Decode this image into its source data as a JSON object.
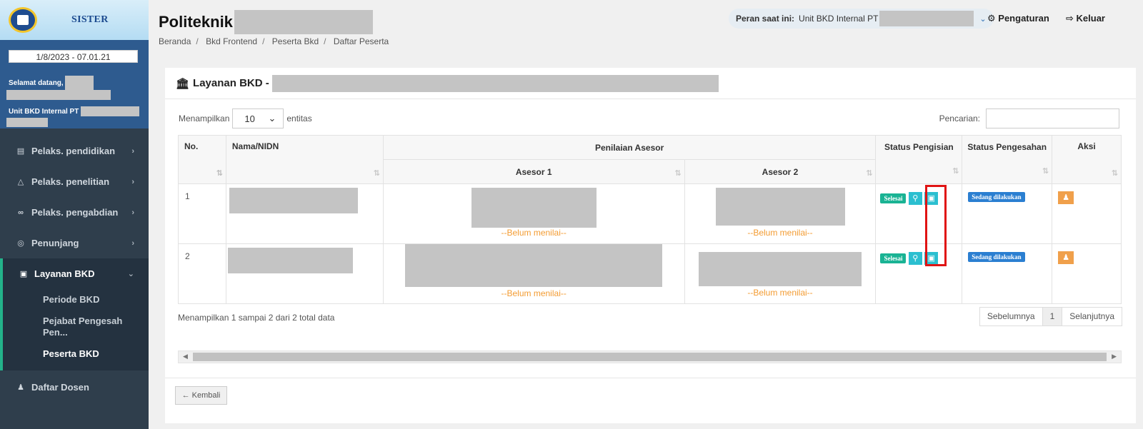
{
  "brand": {
    "name": "SISTER"
  },
  "user": {
    "datetime": "1/8/2023 - 07.01.21",
    "welcome": "Selamat datang,",
    "unit": "Unit BKD Internal PT"
  },
  "sidebar": {
    "items": [
      {
        "label": "Pelaks. pendidikan",
        "icon": "book-icon"
      },
      {
        "label": "Pelaks. penelitian",
        "icon": "flask-icon"
      },
      {
        "label": "Pelaks. pengabdian",
        "icon": "link-icon"
      },
      {
        "label": "Penunjang",
        "icon": "globe-icon"
      },
      {
        "label": "Layanan BKD",
        "icon": "briefcase-icon"
      },
      {
        "label": "Daftar Dosen",
        "icon": "user-icon"
      }
    ],
    "subitems": [
      "Periode BKD",
      "Pejabat Pengesah Pen...",
      "Peserta BKD"
    ]
  },
  "header": {
    "title": "Politeknik",
    "breadcrumb": [
      "Beranda",
      "Bkd Frontend",
      "Peserta Bkd",
      "Daftar Peserta"
    ],
    "role_label": "Peran saat ini:",
    "role_value": "Unit BKD Internal PT",
    "settings_label": "Pengaturan",
    "logout_label": "Keluar"
  },
  "card": {
    "title": "Layanan BKD -",
    "show_label": "Menampilkan",
    "page_size": "10",
    "entries_label": "entitas",
    "search_label": "Pencarian:",
    "search_value": "",
    "back_label": "Kembali"
  },
  "table": {
    "headers": {
      "no": "No.",
      "nama": "Nama/NIDN",
      "penilaian": "Penilaian Asesor",
      "asesor1": "Asesor 1",
      "asesor2": "Asesor 2",
      "status_pengisian": "Status Pengisian",
      "status_pengesahan": "Status Pengesahan",
      "aksi": "Aksi"
    },
    "rows": [
      {
        "no": "1",
        "asesor1_note": "--Belum menilai--",
        "asesor2_note": "--Belum menilai--",
        "status_pengisian": "Selesai",
        "status_pengesahan": "Sedang dilakukan"
      },
      {
        "no": "2",
        "asesor1_note": "--Belum menilai--",
        "asesor2_note": "--Belum menilai--",
        "status_pengisian": "Selesai",
        "status_pengesahan": "Sedang dilakukan"
      }
    ]
  },
  "pagination": {
    "info": "Menampilkan 1 sampai 2 dari 2 total data",
    "prev": "Sebelumnya",
    "page": "1",
    "next": "Selanjutnya"
  },
  "colors": {
    "sidebar_bg": "#2f3e4c",
    "accent_green": "#1ab394",
    "accent_blue": "#2b7fd1",
    "warning": "#f39c33",
    "highlight": "#e01414"
  }
}
